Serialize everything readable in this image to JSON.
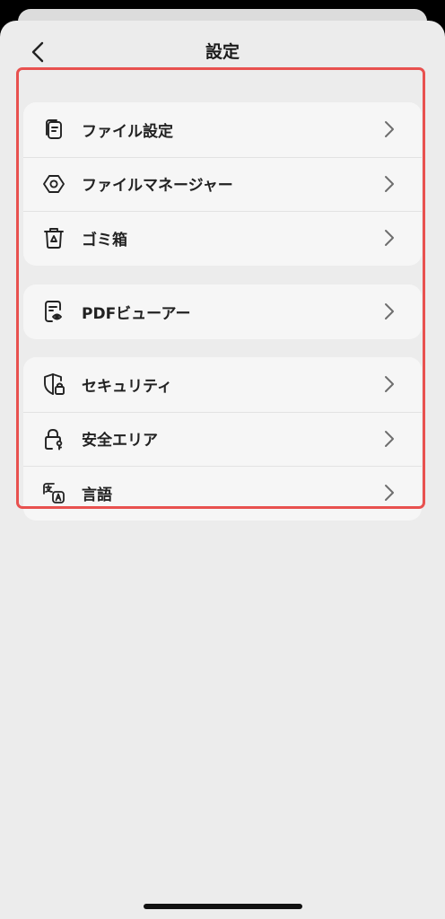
{
  "header": {
    "title": "設定"
  },
  "groups": [
    {
      "items": [
        {
          "label": "ファイル設定",
          "icon": "file-settings-icon"
        },
        {
          "label": "ファイルマネージャー",
          "icon": "hexagon-icon"
        },
        {
          "label": "ゴミ箱",
          "icon": "trash-icon"
        }
      ]
    },
    {
      "items": [
        {
          "label": "PDFビューアー",
          "icon": "document-eye-icon"
        }
      ]
    },
    {
      "items": [
        {
          "label": "セキュリティ",
          "icon": "shield-lock-icon"
        },
        {
          "label": "安全エリア",
          "icon": "lock-key-icon"
        },
        {
          "label": "言語",
          "icon": "translate-icon"
        }
      ]
    }
  ],
  "colors": {
    "highlight": "#e8514f",
    "background": "#ececec",
    "card": "#f6f6f6"
  }
}
